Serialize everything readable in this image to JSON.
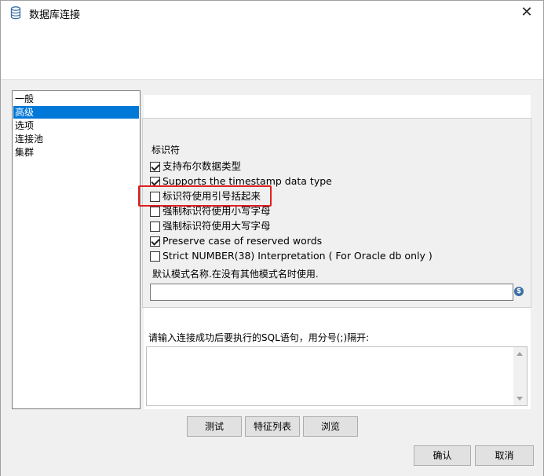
{
  "window": {
    "title": "数据库连接",
    "title_icon": "database-icon",
    "close_glyph": "✕"
  },
  "nav": {
    "items": [
      {
        "label": "一般",
        "selected": false
      },
      {
        "label": "高级",
        "selected": true
      },
      {
        "label": "选项",
        "selected": false
      },
      {
        "label": "连接池",
        "selected": false
      },
      {
        "label": "集群",
        "selected": false
      }
    ]
  },
  "identifiers": {
    "group_label": "标识符",
    "options": [
      {
        "label": "支持布尔数据类型",
        "checked": true
      },
      {
        "label": "Supports the timestamp data type",
        "checked": true
      },
      {
        "label": "标识符使用引号括起来",
        "checked": false
      },
      {
        "label": "强制标识符使用小写字母",
        "checked": false
      },
      {
        "label": "强制标识符使用大写字母",
        "checked": false
      },
      {
        "label": "Preserve case of reserved words",
        "checked": true
      },
      {
        "label": "Strict NUMBER(38) Interpretation ( For Oracle db only )",
        "checked": false
      }
    ]
  },
  "schema": {
    "label": "默认模式名称.在没有其他模式名时使用.",
    "value": "",
    "variable_icon": "variable-icon",
    "variable_glyph": "$"
  },
  "sql": {
    "label": "请输入连接成功后要执行的SQL语句，用分号(;)隔开:",
    "value": ""
  },
  "buttons": {
    "test": "测试",
    "features": "特征列表",
    "explore": "浏览",
    "ok": "确认",
    "cancel": "取消"
  },
  "colors": {
    "selection": "#0078d7",
    "highlight_border": "#e02020"
  }
}
